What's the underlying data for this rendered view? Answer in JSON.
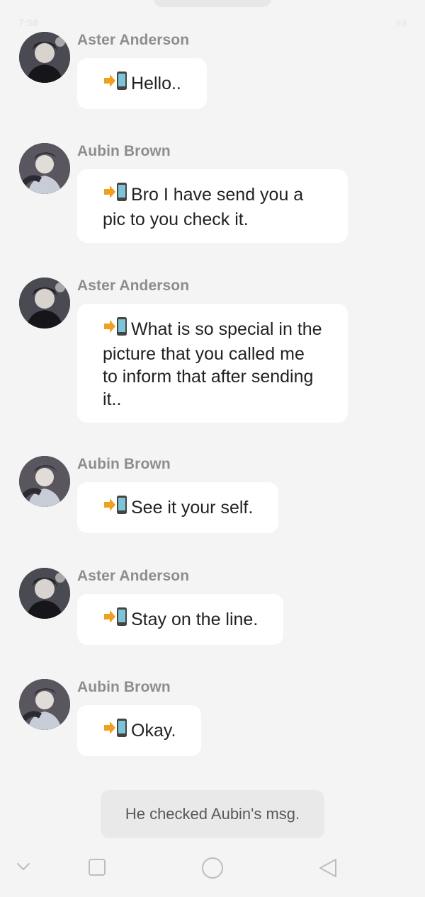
{
  "status": {
    "time": "7:58",
    "battery": "99"
  },
  "messages": [
    {
      "sender": "Aster Anderson",
      "text": "Hello..",
      "avatar": "aster-avatar"
    },
    {
      "sender": "Aubin Brown",
      "text": "Bro I have send you a pic to you check it.",
      "avatar": "aubin-avatar"
    },
    {
      "sender": "Aster Anderson",
      "text": "What is so special in the picture that you called me to inform that after sending it..",
      "avatar": "aster-avatar"
    },
    {
      "sender": "Aubin Brown",
      "text": "See it your self.",
      "avatar": "aubin-avatar"
    },
    {
      "sender": "Aster Anderson",
      "text": "Stay on the line.",
      "avatar": "aster-avatar"
    },
    {
      "sender": "Aubin Brown",
      "text": "Okay.",
      "avatar": "aubin-avatar"
    }
  ],
  "notice": "He checked Aubin's msg.",
  "icons": {
    "message_prefix": "phone-arrow-icon",
    "nav": [
      "chevron-down-icon",
      "recents-square-icon",
      "home-circle-icon",
      "back-triangle-icon"
    ]
  },
  "colors": {
    "background": "#f4f4f4",
    "bubble": "#ffffff",
    "sender": "#8d8d8d",
    "notice_bg": "#e9e9e9",
    "arrow": "#f0a020"
  }
}
